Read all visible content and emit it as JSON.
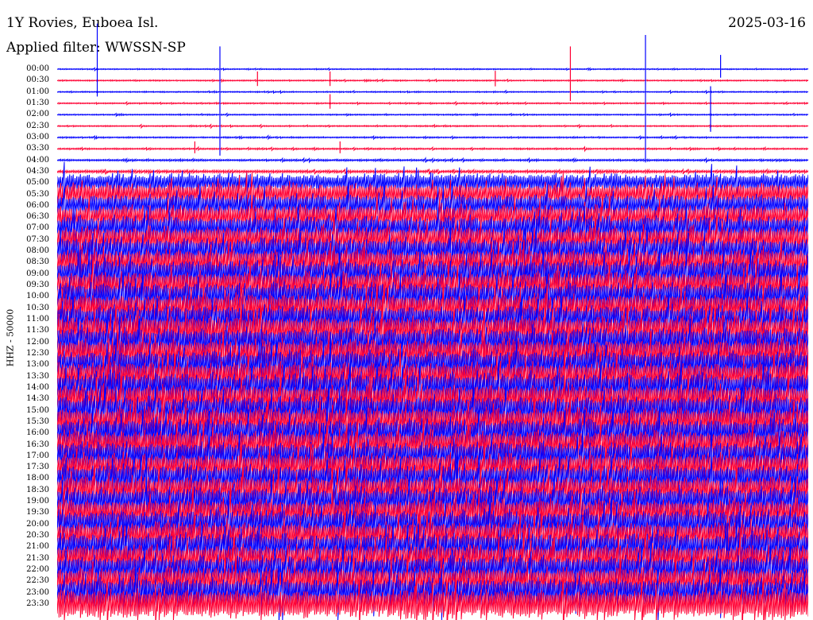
{
  "header": {
    "station": "1Y Rovies, Euboea Isl.",
    "date": "2025-03-16",
    "filter": "Applied filter: WWSSN-SP"
  },
  "chart_data": {
    "type": "line",
    "title": "1Y Rovies, Euboea Isl.",
    "subtitle": "Applied filter: WWSSN-SP",
    "ylabel": "HHZ - 50000",
    "xlabel": "",
    "date": "2025-03-16",
    "grid": false,
    "row_interval_minutes": 30,
    "rows_per_day": 48,
    "row_labels": [
      "00:00",
      "00:30",
      "01:00",
      "01:30",
      "02:00",
      "02:30",
      "03:00",
      "03:30",
      "04:00",
      "04:30",
      "05:00",
      "05:30",
      "06:00",
      "06:30",
      "07:00",
      "07:30",
      "08:00",
      "08:30",
      "09:00",
      "09:30",
      "10:00",
      "10:30",
      "11:00",
      "11:30",
      "12:00",
      "12:30",
      "13:00",
      "13:30",
      "14:00",
      "14:30",
      "15:00",
      "15:30",
      "16:00",
      "16:30",
      "17:00",
      "17:30",
      "18:00",
      "18:30",
      "19:00",
      "19:30",
      "20:00",
      "20:30",
      "21:00",
      "21:30",
      "22:00",
      "22:30",
      "23:00",
      "23:30"
    ],
    "series_colors": [
      "#0000ff",
      "#ff0033"
    ],
    "relative_amplitude": [
      0.22,
      0.24,
      0.24,
      0.25,
      0.25,
      0.26,
      0.27,
      0.32,
      0.4,
      0.6,
      0.85,
      1.0,
      1.05,
      1.1,
      1.15,
      1.2,
      1.25,
      1.25,
      1.3,
      1.3,
      1.3,
      1.3,
      1.3,
      1.35,
      1.35,
      1.35,
      1.35,
      1.35,
      1.35,
      1.35,
      1.35,
      1.35,
      1.35,
      1.35,
      1.3,
      1.3,
      1.3,
      1.3,
      1.3,
      1.3,
      1.3,
      1.3,
      1.3,
      1.3,
      1.3,
      1.3,
      1.3,
      1.35
    ],
    "events": [
      {
        "time": "00:00",
        "offset_min": 1.6,
        "amplitude": 8
      },
      {
        "time": "00:00",
        "offset_min": 26.5,
        "amplitude": 2.5
      },
      {
        "time": "00:30",
        "offset_min": 8.0,
        "amplitude": 1.6
      },
      {
        "time": "00:30",
        "offset_min": 10.9,
        "amplitude": 1.6
      },
      {
        "time": "00:30",
        "offset_min": 17.5,
        "amplitude": 1.7
      },
      {
        "time": "00:30",
        "offset_min": 20.5,
        "amplitude": 6
      },
      {
        "time": "01:30",
        "offset_min": 10.9,
        "amplitude": 1.6
      },
      {
        "time": "02:00",
        "offset_min": 6.5,
        "amplitude": 12
      },
      {
        "time": "02:00",
        "offset_min": 23.5,
        "amplitude": 14
      },
      {
        "time": "02:00",
        "offset_min": 26.1,
        "amplitude": 5
      },
      {
        "time": "03:30",
        "offset_min": 5.5,
        "amplitude": 1.3
      },
      {
        "time": "03:30",
        "offset_min": 11.3,
        "amplitude": 1.3
      }
    ]
  }
}
